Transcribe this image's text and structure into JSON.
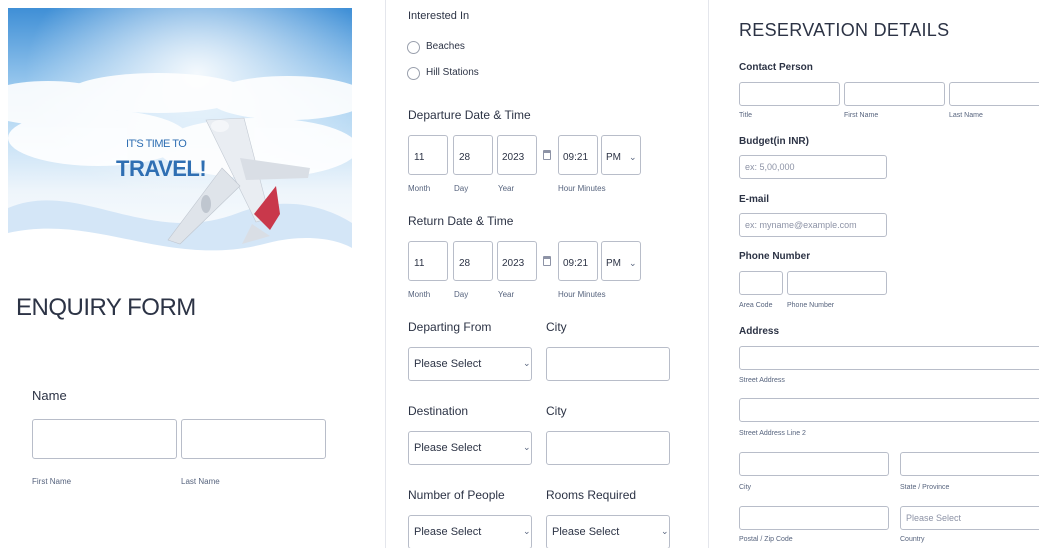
{
  "hero": {
    "tagline_top": "IT'S TIME TO",
    "tagline_main": "TRAVEL!"
  },
  "left": {
    "form_title": "ENQUIRY FORM",
    "name_label": "Name",
    "first_name_sub": "First Name",
    "last_name_sub": "Last Name"
  },
  "middle": {
    "interested_label": "Interested In",
    "options": [
      "Beaches",
      "Hill Stations"
    ],
    "departure_label": "Departure Date & Time",
    "return_label": "Return Date & Time",
    "date_values": {
      "month": "11",
      "day": "28",
      "year": "2023",
      "time": "09:21",
      "ampm": "PM"
    },
    "date_subs": {
      "month": "Month",
      "day": "Day",
      "year": "Year",
      "time": "Hour Minutes"
    },
    "departing_from_label": "Departing From",
    "city_label": "City",
    "destination_label": "Destination",
    "people_label": "Number of People",
    "rooms_label": "Rooms Required",
    "please_select": "Please Select"
  },
  "right": {
    "section_title": "RESERVATION DETAILS",
    "contact_label": "Contact Person",
    "title_sub": "Title",
    "first_name_sub": "First Name",
    "last_name_sub": "Last Name",
    "budget_label": "Budget(in INR)",
    "budget_placeholder": "ex: 5,00,000",
    "email_label": "E-mail",
    "email_placeholder": "ex: myname@example.com",
    "phone_label": "Phone Number",
    "area_code_sub": "Area Code",
    "phone_number_sub": "Phone Number",
    "address_label": "Address",
    "street_sub": "Street Address",
    "street2_sub": "Street Address Line 2",
    "city_sub": "City",
    "state_sub": "State / Province",
    "zip_sub": "Postal / Zip Code",
    "country_sub": "Country",
    "country_placeholder": "Please Select"
  },
  "colors": {
    "sky_top": "#3f8fd6",
    "sky_mid": "#a9d2f2",
    "swoosh": "#d4e6f7",
    "plane_tail": "#c9384b",
    "title_text": "#2c3345",
    "tagline": "#2f6fb3"
  }
}
